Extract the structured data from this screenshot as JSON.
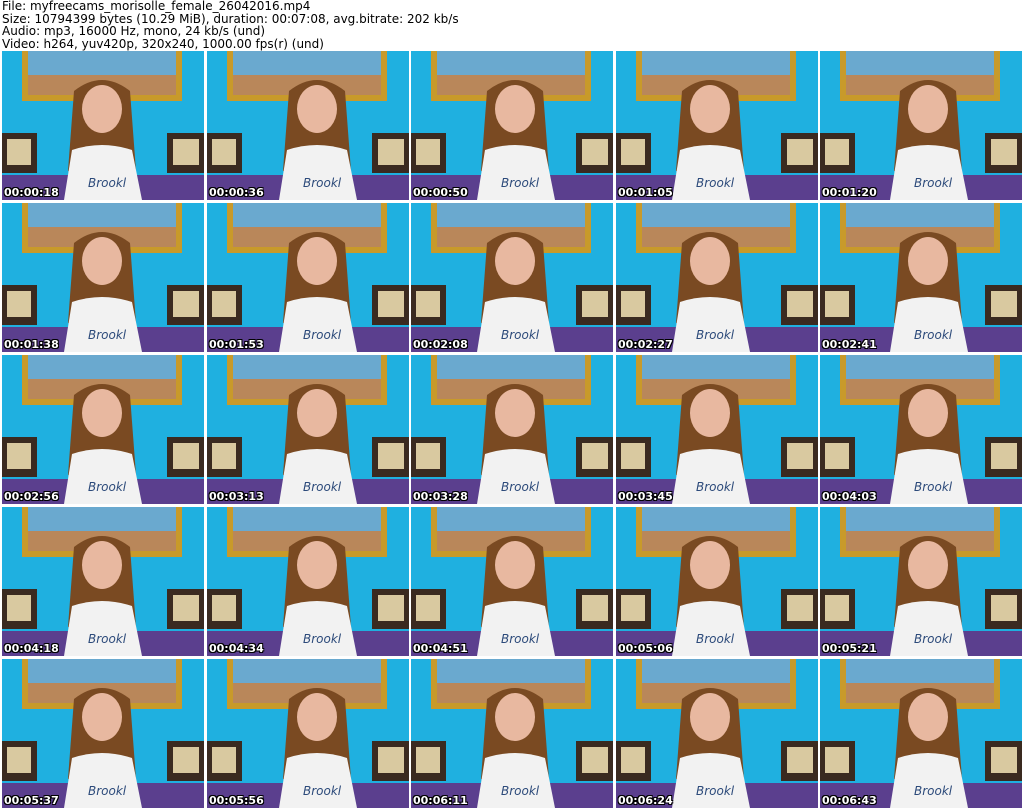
{
  "header": {
    "line1": "File: myfreecams_morisolle_female_26042016.mp4",
    "line2": "Size: 10794399 bytes (10.29 MiB), duration: 00:07:08, avg.bitrate: 202 kb/s",
    "line3": "Audio: mp3, 16000 Hz, mono, 24 kb/s (und)",
    "line4": "Video: h264, yuv420p, 320x240, 1000.00 fps(r) (und)"
  },
  "thumbnails": [
    {
      "time": "00:00:18"
    },
    {
      "time": "00:00:36"
    },
    {
      "time": "00:00:50"
    },
    {
      "time": "00:01:05"
    },
    {
      "time": "00:01:20"
    },
    {
      "time": "00:01:38"
    },
    {
      "time": "00:01:53"
    },
    {
      "time": "00:02:08"
    },
    {
      "time": "00:02:27"
    },
    {
      "time": "00:02:41"
    },
    {
      "time": "00:02:56"
    },
    {
      "time": "00:03:13"
    },
    {
      "time": "00:03:28"
    },
    {
      "time": "00:03:45"
    },
    {
      "time": "00:04:03"
    },
    {
      "time": "00:04:18"
    },
    {
      "time": "00:04:34"
    },
    {
      "time": "00:04:51"
    },
    {
      "time": "00:05:06"
    },
    {
      "time": "00:05:21"
    },
    {
      "time": "00:05:37"
    },
    {
      "time": "00:05:56"
    },
    {
      "time": "00:06:11"
    },
    {
      "time": "00:06:24"
    },
    {
      "time": "00:06:43"
    }
  ],
  "colors": {
    "wall": "#1fb0e0",
    "frame": "#c89a2a",
    "bed": "#5b3f8e",
    "hair": "#7a4a22",
    "skin": "#e8b8a0",
    "shirt": "#f2f2f2"
  }
}
